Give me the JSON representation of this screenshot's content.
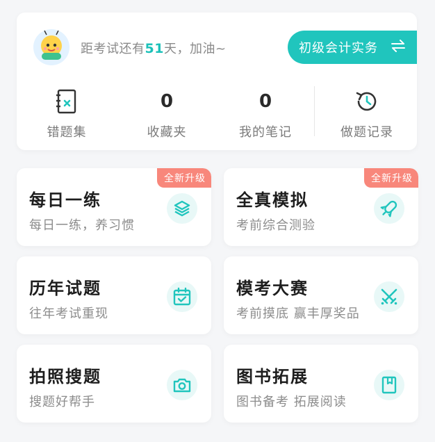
{
  "header": {
    "countdown_prefix": "距考试还有",
    "days": "51",
    "countdown_suffix": "天，加油~",
    "subject_label": "初级会计实务",
    "subject_icon": "swap-icon"
  },
  "stats": [
    {
      "label": "错题集",
      "icon": "wrong-notebook-icon"
    },
    {
      "label": "收藏夹",
      "value": "0"
    },
    {
      "label": "我的笔记",
      "value": "0"
    },
    {
      "label": "做题记录",
      "icon": "history-icon"
    }
  ],
  "features": [
    {
      "title": "每日一练",
      "subtitle": "每日一练，养习惯",
      "badge": "全新升级",
      "icon": "layers-icon"
    },
    {
      "title": "全真模拟",
      "subtitle": "考前综合测验",
      "badge": "全新升级",
      "icon": "rocket-icon"
    },
    {
      "title": "历年试题",
      "subtitle": "往年考试重现",
      "icon": "calendar-icon"
    },
    {
      "title": "模考大赛",
      "subtitle": "考前摸底 赢丰厚奖品",
      "icon": "crossed-swords-icon"
    },
    {
      "title": "拍照搜题",
      "subtitle": "搜题好帮手",
      "icon": "camera-icon"
    },
    {
      "title": "图书拓展",
      "subtitle": "图书备考 拓展阅读",
      "icon": "book-icon"
    }
  ],
  "colors": {
    "accent": "#20c5bd",
    "badge": "#f8877b",
    "icon_bg": "#e8f8f7"
  }
}
